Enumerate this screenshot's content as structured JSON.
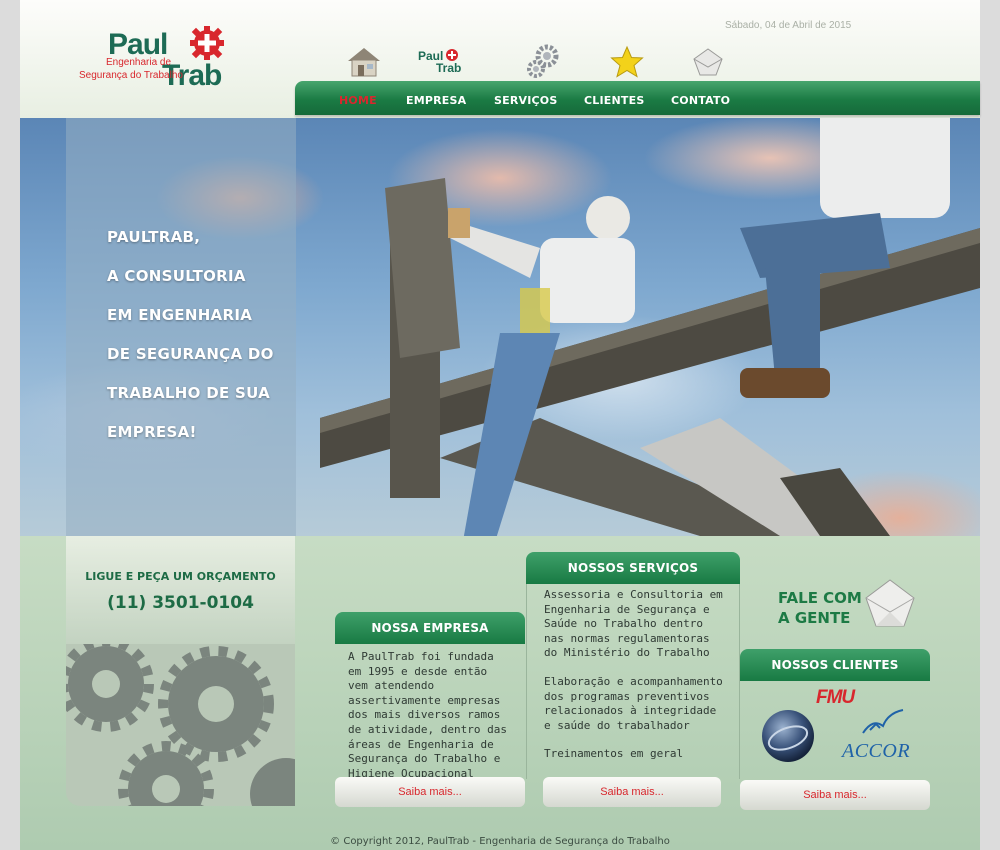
{
  "header": {
    "date": "Sábado, 04 de Abril de 2015",
    "logo": {
      "word1": "Paul",
      "word2": "Trab",
      "tagline1": "Engenharia de",
      "tagline2": "Segurança do Trabalho"
    }
  },
  "nav": {
    "icons": [
      "house-icon",
      "paultrab-logo-icon",
      "gears-icon",
      "star-icon",
      "envelope-icon"
    ],
    "items": [
      {
        "label": "HOME",
        "active": true
      },
      {
        "label": "EMPRESA"
      },
      {
        "label": "SERVIÇOS"
      },
      {
        "label": "CLIENTES"
      },
      {
        "label": "CONTATO"
      }
    ],
    "active_color": "#d9272e",
    "bar_color": "#1b7b44"
  },
  "hero": {
    "lines": [
      "PAULTRAB,",
      "A CONSULTORIA",
      "EM ENGENHARIA",
      "DE SEGURANÇA DO",
      "TRABALHO DE SUA",
      "EMPRESA!"
    ]
  },
  "quote": {
    "line1": "LIGUE E PEÇA UM ORÇAMENTO",
    "phone": "(11) 3501-0104"
  },
  "empresa": {
    "title": "NOSSA EMPRESA",
    "text": "A PaulTrab foi fundada em 1995 e desde então vem atendendo assertivamente empresas dos mais diversos ramos de atividade, dentro das áreas de Engenharia de Segurança do Trabalho e Higiene Ocupacional",
    "more": "Saiba mais..."
  },
  "servicos": {
    "title": "NOSSOS SERVIÇOS",
    "items": [
      "Assessoria e Consultoria em Engenharia de Segurança e Saúde no Trabalho dentro nas normas regulamentoras do Ministério do Trabalho",
      "Elaboração e acompanhamento dos programas preventivos relacionados à integridade e saúde do trabalhador",
      "Treinamentos em geral"
    ],
    "more": "Saiba mais..."
  },
  "fale": {
    "line1": "FALE COM",
    "line2": "A GENTE"
  },
  "clientes": {
    "title": "NOSSOS CLIENTES",
    "logos": [
      "FMU",
      "ACCOR"
    ],
    "more": "Saiba mais..."
  },
  "footer": {
    "text": "© Copyright 2012, PaulTrab - Engenharia de Segurança do Trabalho"
  },
  "colors": {
    "brand_green": "#1d6b55",
    "brand_red": "#d8272d"
  }
}
